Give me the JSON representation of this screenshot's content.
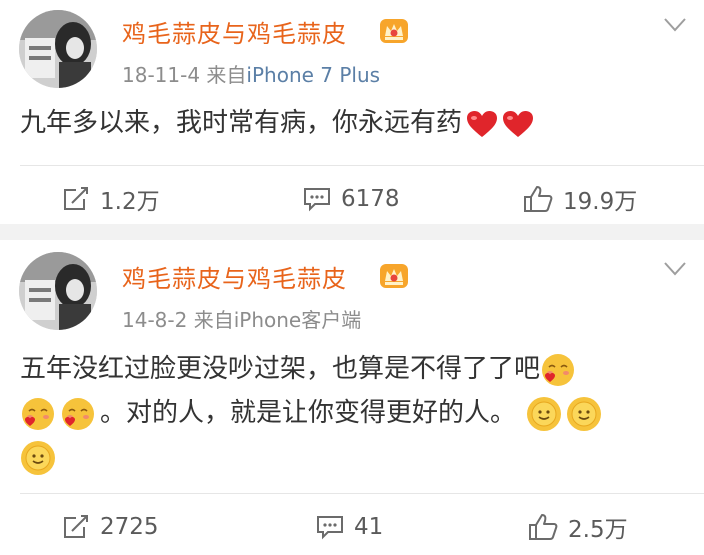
{
  "posts": [
    {
      "username": "鸡毛蒜皮与鸡毛蒜皮",
      "date": "18-11-4",
      "via": "来自",
      "source": "iPhone 7 Plus",
      "text": "九年多以来，我时常有病，你永远有药",
      "repost_count": "1.2万",
      "comment_count": "6178",
      "like_count": "19.9万"
    },
    {
      "username": "鸡毛蒜皮与鸡毛蒜皮",
      "date": "14-8-2",
      "via": "来自",
      "source": "iPhone客户端",
      "line1": "五年没红过脸更没吵过架，也算是不得了了吧",
      "line2": "。对的人，就是让你变得更好的人。",
      "repost_count": "2725",
      "comment_count": "41",
      "like_count": "2.5万"
    }
  ],
  "colors": {
    "username": "#e8641b",
    "meta": "#8c8c8c",
    "body_text": "#333333",
    "separator": "#f2f2f2",
    "heart": "#e0252b",
    "emoji": "#f6c33b"
  },
  "icons": [
    "avatar",
    "crown-icon",
    "chevron-down-icon",
    "heart-emoji",
    "blush-emoji",
    "sun-emoji",
    "repost-icon",
    "comment-icon",
    "like-icon"
  ]
}
